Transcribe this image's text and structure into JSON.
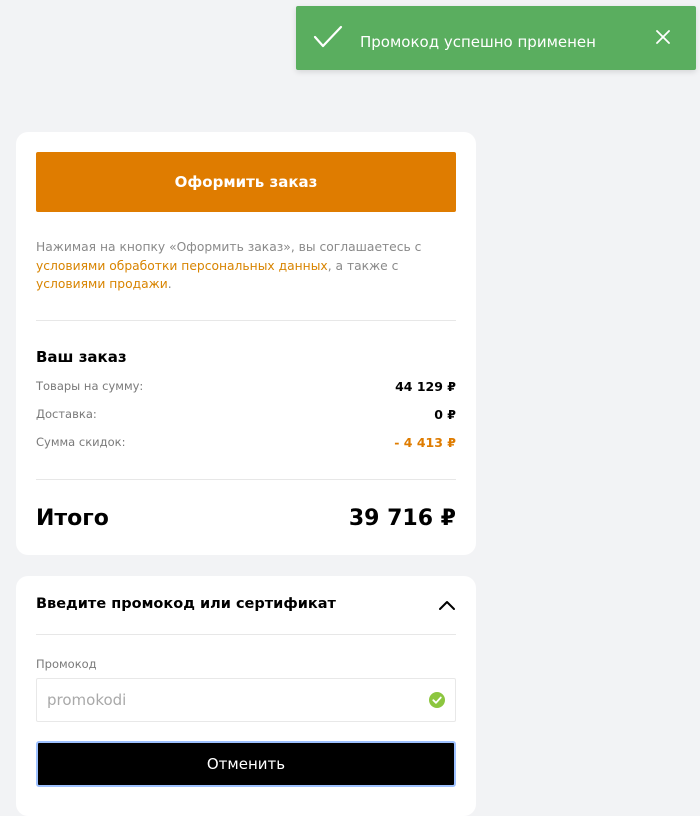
{
  "toast": {
    "icon": "checkmark-icon",
    "message": "Промокод успешно применен",
    "close_icon": "close-icon",
    "color": "#5aae5f"
  },
  "checkout": {
    "button_label": "Оформить заказ",
    "button_color": "#df7c00",
    "agreement_prefix": "Нажимая на кнопку «Оформить заказ», вы соглашаетесь с ",
    "agreement_link1": "условиями обработки персональных данных",
    "agreement_middle": ", а также с ",
    "agreement_link2": "условиями продажи",
    "agreement_suffix": "."
  },
  "order": {
    "title": "Ваш заказ",
    "rows": [
      {
        "label": "Товары на сумму:",
        "value": "44 129 ₽"
      },
      {
        "label": "Доставка:",
        "value": "0 ₽"
      },
      {
        "label": "Сумма скидок:",
        "value": "- 4 413 ₽"
      }
    ],
    "total_label": "Итого",
    "total_value": "39 716 ₽"
  },
  "promo": {
    "title": "Введите промокод или сертификат",
    "chevron_icon": "chevron-up-icon",
    "field_label": "Промокод",
    "value": "promokodi",
    "status_icon": "valid-check-icon",
    "cancel_label": "Отменить"
  }
}
